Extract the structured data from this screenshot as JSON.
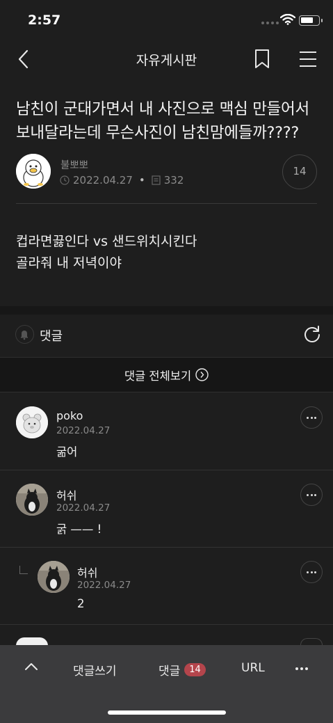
{
  "status_bar": {
    "time": "2:57"
  },
  "header": {
    "title": "자유게시판"
  },
  "post": {
    "title": "남친이 군대가면서 내 사진으로 맥심 만들어서 보내달라는데 무슨사진이 남친맘에들까????",
    "author": "불뽀뽀",
    "date": "2022.04.27",
    "views": "332",
    "comment_count": "14",
    "body_line1": "컵라면끓인다 vs 샌드위치시킨다",
    "body_line2": "골라줘 내 저녁이야"
  },
  "comments_section": {
    "label": "댓글",
    "view_all": "댓글 전체보기"
  },
  "comments": [
    {
      "name": "poko",
      "date": "2022.04.27",
      "text": "굶어"
    },
    {
      "name": "허쉬",
      "date": "2022.04.27",
      "text": "굵 —— !"
    },
    {
      "name": "허쉬",
      "date": "2022.04.27",
      "text": "2"
    }
  ],
  "bottom_bar": {
    "write_comment": "댓글쓰기",
    "comments_label": "댓글",
    "comments_badge": "14",
    "url": "URL"
  },
  "colors": {
    "background": "#1e1e1e",
    "badge": "#b4454c",
    "bottom_bar": "#3b3b3d"
  }
}
